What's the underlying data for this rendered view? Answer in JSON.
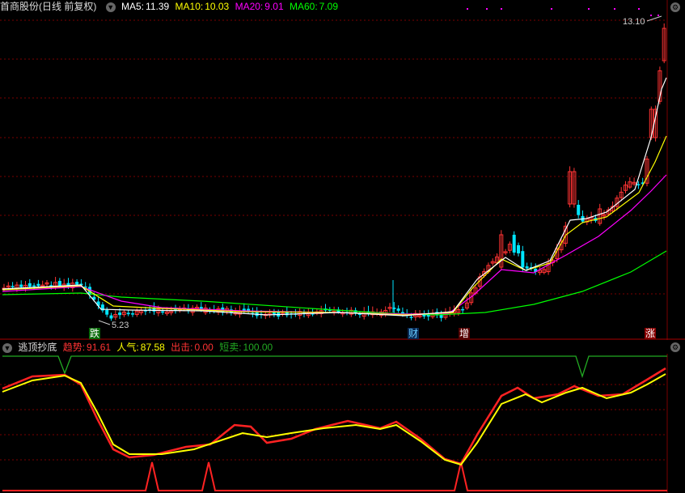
{
  "main_panel": {
    "title": "首商股份(日线 前复权)",
    "ma": [
      {
        "label": "MA5:",
        "value": "11.39",
        "color": "#ffffff"
      },
      {
        "label": "MA10:",
        "value": "10.03",
        "color": "#ffff00"
      },
      {
        "label": "MA20:",
        "value": "9.01",
        "color": "#ff00ff"
      },
      {
        "label": "MA60:",
        "value": "7.09",
        "color": "#00ff00"
      }
    ],
    "high_label": "13.10",
    "low_label": "5.23",
    "markers": {
      "fall": "跌",
      "finance": "财",
      "increase": "增",
      "limit_up": "涨"
    }
  },
  "indicator_panel": {
    "title": "逃顶抄底",
    "items": [
      {
        "label": "趋势:",
        "value": "91.61",
        "color": "#ff3333"
      },
      {
        "label": "人气:",
        "value": "87.58",
        "color": "#ffff00"
      },
      {
        "label": "出击:",
        "value": "0.00",
        "color": "#ff3333"
      },
      {
        "label": "短卖:",
        "value": "100.00",
        "color": "#22aa22"
      }
    ]
  },
  "colors": {
    "up": "#ff3333",
    "down": "#00e5ff",
    "grid": "#7a0000",
    "bg": "#000000"
  },
  "icons": {
    "collapse": "chevron-down-icon",
    "settings": "gear-icon"
  },
  "chart_data": [
    {
      "type": "candlestick",
      "series": [
        {
          "name": "MA5",
          "color": "#ffffff"
        },
        {
          "name": "MA10",
          "color": "#ffff00"
        },
        {
          "name": "MA20",
          "color": "#ff00ff"
        },
        {
          "name": "MA60",
          "color": "#00ff00"
        }
      ],
      "annotations": [
        "13.10",
        "5.23",
        "跌",
        "财",
        "增",
        "涨"
      ]
    },
    {
      "type": "line",
      "series": [
        {
          "name": "趋势",
          "color": "#ff3333"
        },
        {
          "name": "人气",
          "color": "#ffff00"
        },
        {
          "name": "出击",
          "color": "#ff3333"
        },
        {
          "name": "短卖",
          "color": "#22aa22"
        }
      ]
    }
  ]
}
